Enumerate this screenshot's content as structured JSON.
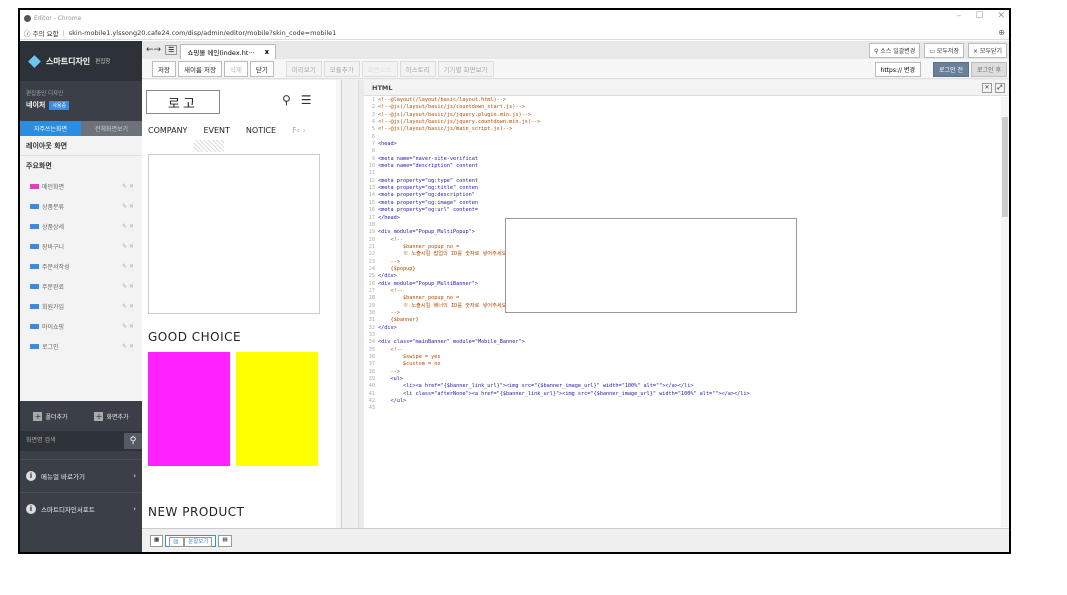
{
  "window": {
    "title": "Editor - Chrome",
    "minimize": "–",
    "maximize": "☐",
    "close": "✕"
  },
  "address": {
    "security": "ⓘ 주의 요함",
    "url": "skin-mobile1.ylssong20.cafe24.com/disp/admin/editor/mobile?skin_code=mobile1"
  },
  "sidebar": {
    "logo": "스마트디자인",
    "logo_sub": "편집창",
    "design_label": "편집중인 디자인",
    "design_name": "네이처",
    "design_badge": "사용중",
    "tabs": [
      {
        "label": "자주쓰는화면"
      },
      {
        "label": "전체화면보기"
      }
    ],
    "section_layout": "레이아웃 화면",
    "section_main": "주요화면",
    "items": [
      {
        "label": "메인화면",
        "color": "#e040c0"
      },
      {
        "label": "상품분류",
        "color": "#3b8be0"
      },
      {
        "label": "상품상세",
        "color": "#3b8be0"
      },
      {
        "label": "장바구니",
        "color": "#3b8be0"
      },
      {
        "label": "주문서작성",
        "color": "#3b8be0"
      },
      {
        "label": "주문완료",
        "color": "#3b8be0"
      },
      {
        "label": "회원가입",
        "color": "#3b8be0"
      },
      {
        "label": "마이쇼핑",
        "color": "#3b8be0"
      },
      {
        "label": "로그인",
        "color": "#3b8be0"
      }
    ],
    "add_folder": "폴더추가",
    "add_screen": "화면추가",
    "search_placeholder": "화면명 검색",
    "link_manual": "메뉴얼 바로가기",
    "link_store": "스마트디자인서포트"
  },
  "tabbar": {
    "file_tab": "쇼핑몰 메인(index.ht···",
    "close": "x",
    "btn_source": "소스 일괄변경",
    "btn_saveall": "모두저장",
    "btn_closeall": "× 모두닫기"
  },
  "toolbar": {
    "save": "저장",
    "save_as": "새이름 저장",
    "delete": "삭제",
    "close": "닫기",
    "preview": "미리보기",
    "module_add": "모듈추가",
    "disabled": "화면소스",
    "history": "히스토리",
    "screen_size": "기기별 화면보기",
    "https": "https:// 변경",
    "login_before": "로그인 전",
    "login_after": "로그인 후"
  },
  "preview": {
    "logo": "로고",
    "nav": [
      "COMPANY",
      "EVENT",
      "NOTICE",
      "F‹ ›"
    ],
    "heading1": "GOOD CHOICE",
    "heading2": "NEW PRODUCT",
    "swatch1": "#ff21ff",
    "swatch2": "#ffff00"
  },
  "editor": {
    "title": "HTML",
    "lines": [
      "<!--@layout(/layout/basic/layout.html)-->",
      "<!--@js(/layout/basic/js/countdown_start.js)-->",
      "<!--@js(/layout/basic/js/jquery.plugin.min.js)-->",
      "<!--@js(/layout/basic/js/jquery.countdown.min.js)-->",
      "<!--@js(/layout/basic/js/main_script.js)-->",
      "",
      "<head>",
      "",
      "<meta name=\"naver-site-verificat",
      "<meta name=\"description\" content",
      "",
      "<meta property=\"og:type\" content",
      "<meta property=\"og:title\" conten",
      "<meta property=\"og:description\"",
      "<meta property=\"og:image\" conten",
      "<meta property=\"og:url\" content=",
      "</head>",
      "",
      "<div module=\"Popup_MultiPopup\">",
      "    <!--",
      "        $banner_popup_no =",
      "        ※ 노출시킬 팝업의 ID를 숫자로 넣어주세요.",
      "    -->",
      "    {$popup}",
      "</div>",
      "<div module=\"Popup_MultiBanner\">",
      "    <!--",
      "        $banner_popup_no =",
      "        ※ 노출시킬 배너의 ID를 숫자로 넣어주세요.",
      "    -->",
      "    {$banner}",
      "</div>",
      "",
      "<div class=\"mainBanner\" module=\"Mobile_Banner\">",
      "    <!--",
      "        $swipe = yes",
      "        $custom = no",
      "    -->",
      "    <ul>",
      "        <li><a href=\"{$banner_link_url}\"><img src=\"{$banner_image_url}\" width=\"100%\" alt=\"\"></a></li>",
      "        <li class=\"afterNone\"><a href=\"{$banner_link_url}\"><img src=\"{$banner_image_url}\" width=\"100%\" alt=\"\"></a></li>",
      "    </ul>",
      ""
    ]
  },
  "bottombar": {
    "split": "분할보기"
  }
}
